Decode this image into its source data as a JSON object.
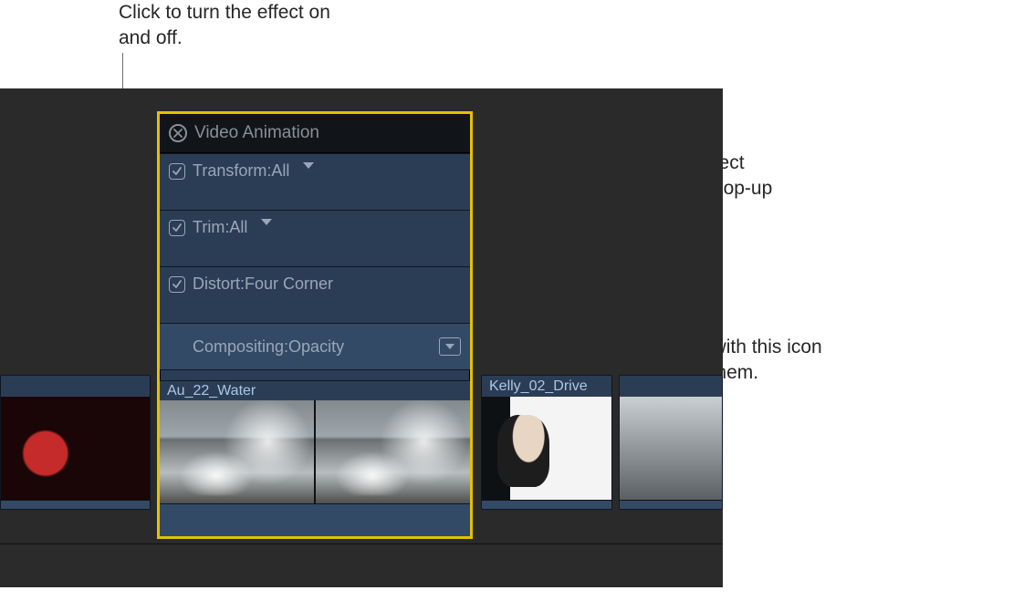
{
  "callouts": {
    "top": "Click to turn the effect on and off.",
    "right1": "Choose a specific effect parameter from this pop-up menu.",
    "right2": "Double-click effects with this icon to vertically expand them."
  },
  "panel": {
    "title": "Video Animation",
    "rows": {
      "transform": "Transform:All",
      "trim": "Trim:All",
      "distort": "Distort:Four Corner",
      "compositing": "Compositing:Opacity"
    },
    "clip_label": "Au_22_Water"
  },
  "timeline": {
    "clip_right_label": "Kelly_02_Drive"
  }
}
